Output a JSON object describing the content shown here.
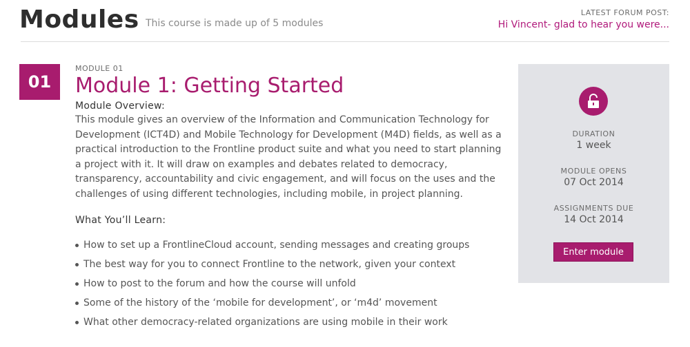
{
  "header": {
    "title": "Modules",
    "subtitle": "This course is made up of 5 modules",
    "forum_label": "LATEST FORUM POST:",
    "forum_post": "Hi Vincent- glad to hear you were..."
  },
  "module": {
    "badge": "01",
    "number_label": "MODULE 01",
    "title": "Module 1: Getting Started",
    "overview_heading": "Module Overview:",
    "overview_text": "This module gives an overview of the Information and Communication Technology for Development (ICT4D) and Mobile Technology for Development (M4D) fields, as well as a practical introduction to the Frontline product suite and what you need to start planning a project with it.  It will draw on examples and debates related to democracy, transparency, accountability and civic engagement, and will focus on the uses and the challenges of using different technologies, including mobile, in project planning.",
    "learn_heading": "What You’ll Learn:",
    "learn_items": [
      "How to set up a FrontlineCloud account, sending messages and creating groups",
      "The best way for you to connect Frontline to the network, given your context",
      "How to post to the forum and how the course will unfold",
      "Some of the history of the ‘mobile for development’, or ‘m4d’ movement",
      "What other democracy-related organizations are using mobile in their work"
    ]
  },
  "sidebar": {
    "icon": "unlocked-padlock-icon",
    "duration_label": "DURATION",
    "duration_value": "1 week",
    "opens_label": "MODULE OPENS",
    "opens_value": "07 Oct 2014",
    "due_label": "ASSIGNMENTS DUE",
    "due_value": "14 Oct 2014",
    "enter_button": "Enter module"
  },
  "colors": {
    "accent": "#a81c6e",
    "panel": "#e2e3e7"
  }
}
